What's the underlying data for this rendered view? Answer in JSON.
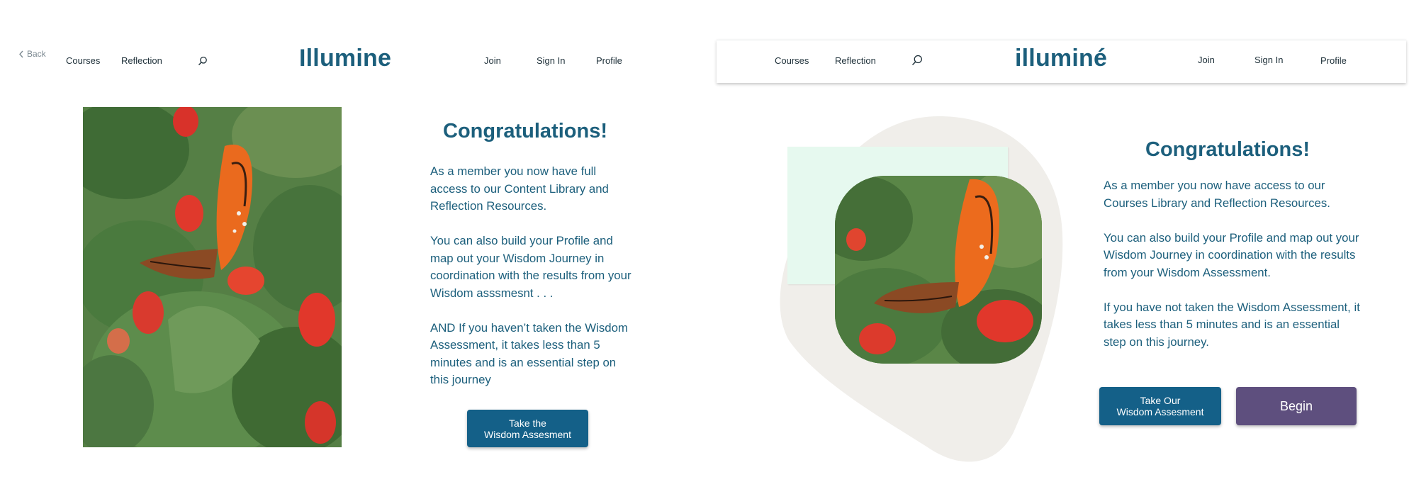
{
  "colors": {
    "brand": "#1c5f7c",
    "button_teal": "#146088",
    "button_purple": "#5e4f7e",
    "blob": "#f0eeea",
    "mint": "#e6f9ef"
  },
  "left": {
    "back_label": "Back",
    "nav": {
      "courses": "Courses",
      "reflection": "Reflection",
      "join": "Join",
      "sign_in": "Sign In",
      "profile": "Profile"
    },
    "brand": "Illumine",
    "headline": "Congratulations!",
    "paragraphs": [
      "As a member you now have full access to our Content Library and Reflection Resources.",
      "You can also build your Profile and map out your Wisdom Journey in coordination with the results from your Wisdom asssmesnt . . .",
      "AND If you haven’t taken the Wisdom Assessment, it takes less than 5 minutes and is an essential step on this journey"
    ],
    "button_line1": "Take the",
    "button_line2": "Wisdom Assesment"
  },
  "right": {
    "nav": {
      "courses": "Courses",
      "reflection": "Reflection",
      "join": "Join",
      "sign_in": "Sign In",
      "profile": "Profile"
    },
    "brand": "illuminé",
    "headline": "Congratulations!",
    "paragraphs": [
      "As a member you now have access to our Courses Library and Reflection Resources.",
      "You can also build your Profile and map out your Wisdom Journey in coordination with the results from your Wisdom Assessment.",
      "If you have not taken the Wisdom Assessment, it takes less than 5 minutes and is an essential step on this journey."
    ],
    "button_line1": "Take Our",
    "button_line2": "Wisdom Assesment",
    "begin_label": "Begin"
  }
}
